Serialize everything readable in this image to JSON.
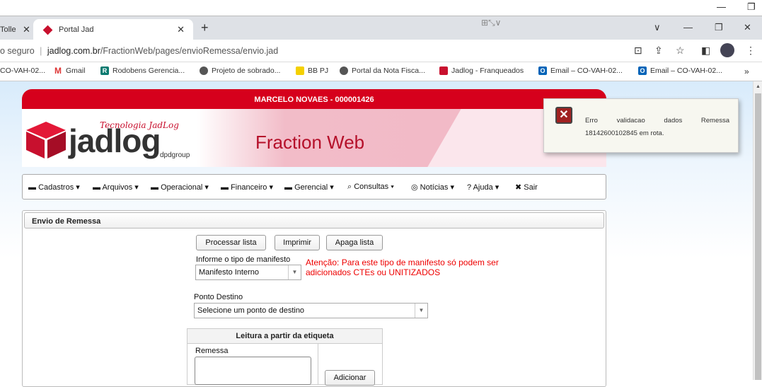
{
  "os": {
    "minimize": "—",
    "restore": "❐"
  },
  "tabs": [
    {
      "label": "Tolle",
      "close": "✕"
    },
    {
      "label": "Portal Jad",
      "close": "✕"
    }
  ],
  "new_tab": "+",
  "window": {
    "down": "∨",
    "min": "—",
    "max": "❐",
    "close": "✕"
  },
  "address": {
    "security": "o seguro",
    "sep": "|",
    "host": "jadlog.com.br",
    "path": "/FractionWeb/pages/envioRemessa/envio.jad"
  },
  "bookmarks": [
    {
      "label": "CO-VAH-02...",
      "icon": ""
    },
    {
      "label": "Gmail",
      "icon": "M"
    },
    {
      "label": "Rodobens Gerencia...",
      "icon": "R"
    },
    {
      "label": "Projeto de sobrado...",
      "icon": ""
    },
    {
      "label": "BB PJ",
      "icon": ""
    },
    {
      "label": "Portal da Nota Fisca...",
      "icon": ""
    },
    {
      "label": "Jadlog - Franqueados",
      "icon": ""
    },
    {
      "label": "Email – CO-VAH-02...",
      "icon": "O"
    },
    {
      "label": "Email – CO-VAH-02...",
      "icon": "O"
    }
  ],
  "bookmarks_more": "»",
  "user_banner": "MARCELO NOVAES - 000001426",
  "logo": {
    "tagline": "Tecnologia JadLog",
    "name": "jadlog",
    "group": "dpdgroup"
  },
  "app_title": "Fraction Web",
  "menu": [
    {
      "label": "Cadastros ▾"
    },
    {
      "label": "Arquivos ▾"
    },
    {
      "label": "Operacional ▾"
    },
    {
      "label": "Financeiro ▾"
    },
    {
      "label": "Gerencial ▾"
    },
    {
      "label": "Consultas ▾"
    },
    {
      "label": "Notícias ▾"
    },
    {
      "label": "Ajuda ▾"
    },
    {
      "label": "Sair"
    }
  ],
  "panel_title": "Envio de Remessa",
  "buttons": {
    "process": "Processar lista",
    "print": "Imprimir",
    "clear": "Apaga lista",
    "add": "Adicionar"
  },
  "manifest": {
    "label": "Informe o tipo de manifesto",
    "value": "Manifesto Interno"
  },
  "warning": "Atenção: Para este tipo de manifesto só podem ser adicionados CTEs ou UNITIZADOS",
  "destination": {
    "label": "Ponto Destino",
    "value": "Selecione um ponto de destino"
  },
  "reading": {
    "title": "Leitura a partir da etiqueta",
    "field_label": "Remessa"
  },
  "toast": {
    "w1": "Erro",
    "w2": "validacao",
    "w3": "dados",
    "w4": "Remessa",
    "line2": "18142600102845 em rota."
  },
  "colors": {
    "brand_red": "#d6001c",
    "error_red": "#ee0000"
  }
}
